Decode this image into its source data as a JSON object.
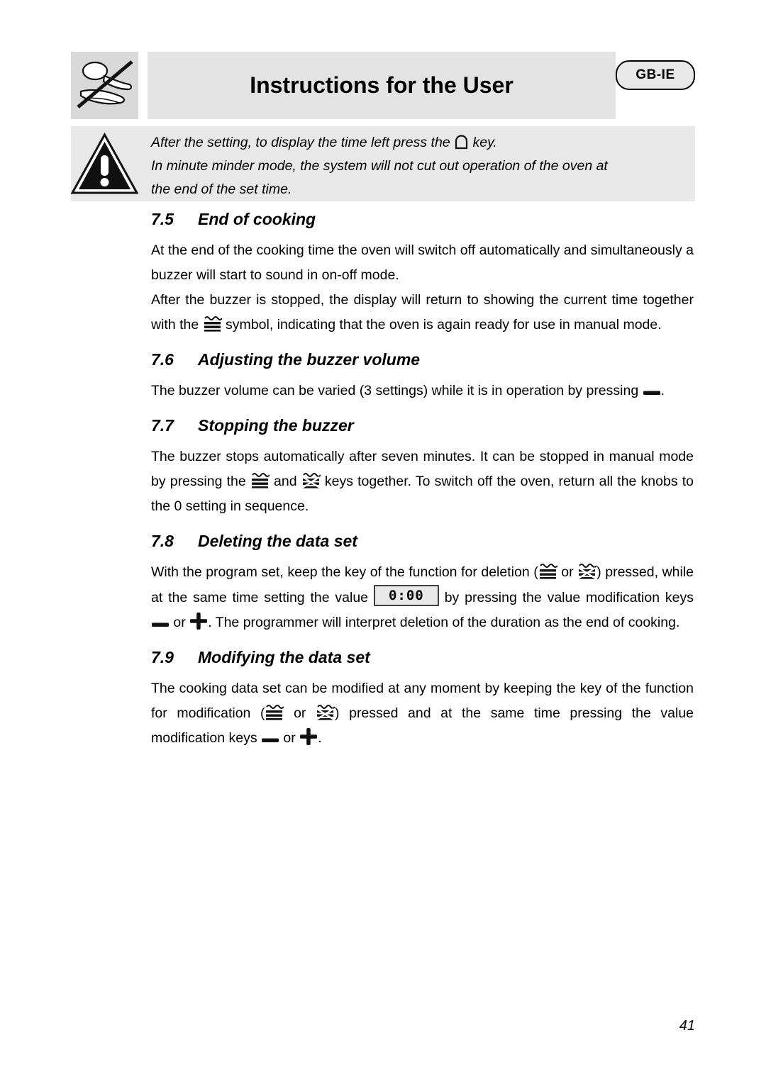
{
  "header": {
    "title": "Instructions for the User",
    "language_badge": "GB-IE",
    "logo_icon": "spoon-crossed-out-icon"
  },
  "warning": {
    "icon": "warning-triangle-icon",
    "line1_a": "After the setting, to display the time left press the",
    "line1_icon": "minute-minder-bell-icon",
    "line1_b": "key.",
    "line2": "In minute minder mode, the system will not cut out operation of the oven at",
    "line3": "the end of the set time."
  },
  "sections": [
    {
      "number": "7.5",
      "title": "End of cooking",
      "paragraphs": [
        "At the end of the cooking time the oven will switch off automatically and simultaneously a buzzer will start to sound in on-off mode.",
        "After the buzzer is stopped, the display will return to showing the current time together with the",
        "symbol, indicating that the oven is again ready for use in manual mode."
      ]
    },
    {
      "number": "7.6",
      "title": "Adjusting the buzzer volume",
      "paragraphs": [
        "The buzzer volume can be varied (3 settings) while it is in operation by pressing",
        "."
      ]
    },
    {
      "number": "7.7",
      "title": "Stopping the buzzer",
      "paragraphs": [
        "The buzzer stops automatically after seven minutes. It can be stopped in manual mode by pressing the",
        "and",
        "keys together. To switch off the oven, return all the knobs to the 0 setting in sequence."
      ]
    },
    {
      "number": "7.8",
      "title": "Deleting the data set",
      "paragraphs": [
        "With the program set, keep the key of the function for deletion (",
        "or",
        ") pressed, while at the same time setting the value",
        "by pressing the value modification keys",
        "or",
        ". The programmer will interpret deletion of the duration as the end of cooking."
      ],
      "display_value": "0:00"
    },
    {
      "number": "7.9",
      "title": "Modifying the data set",
      "paragraphs": [
        "The cooking data set can be modified at any moment by keeping the key of the function for modification (",
        "or",
        ") pressed and at the same time pressing the value modification keys",
        "or",
        "."
      ]
    }
  ],
  "icons": {
    "cooking_time": "cooking-time-key-icon",
    "end_of_cooking": "end-of-cooking-key-icon",
    "minus": "minus-key-icon",
    "plus": "plus-key-icon",
    "bell": "minute-minder-key-icon"
  },
  "page_number": "41"
}
